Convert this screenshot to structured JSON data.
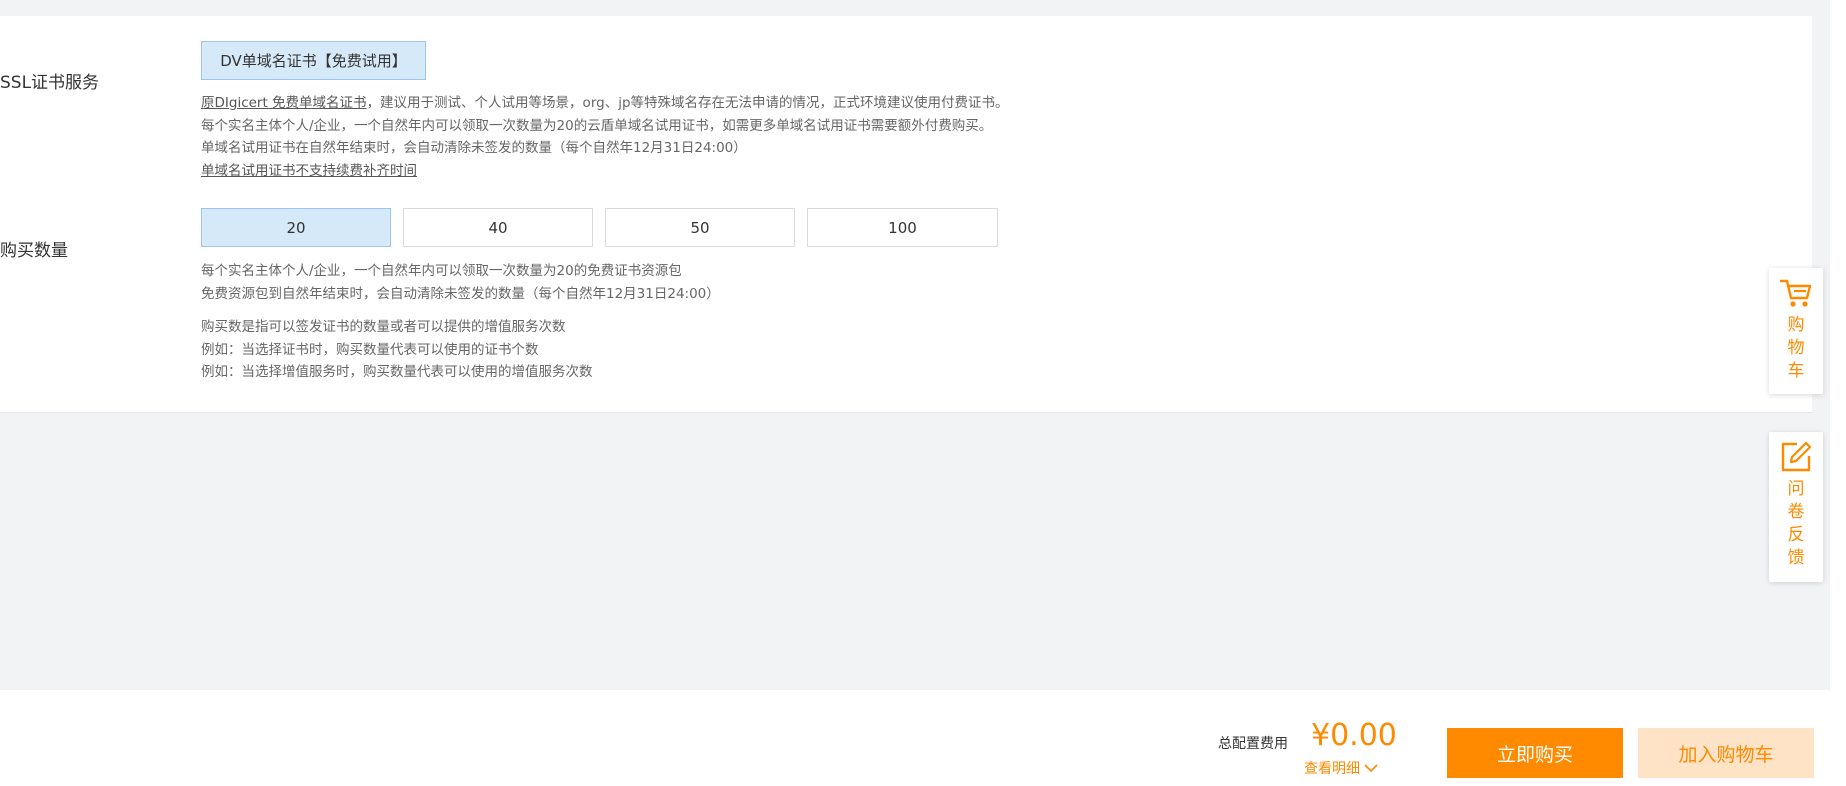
{
  "ssl_section": {
    "label": "SSL证书服务",
    "option": "DV单域名证书【免费试用】",
    "desc_link": "原DIgicert 免费单域名证书",
    "desc_line1_rest": "，建议用于测试、个人试用等场景，org、jp等特殊域名存在无法申请的情况，正式环境建议使用付费证书。",
    "desc_line2": "每个实名主体个人/企业，一个自然年内可以领取一次数量为20的云盾单域名试用证书，如需更多单域名试用证书需要额外付费购买。",
    "desc_line3": "单域名试用证书在自然年结束时，会自动清除未签发的数量（每个自然年12月31日24:00）",
    "desc_line4": "单域名试用证书不支持续费补齐时间"
  },
  "quantity_section": {
    "label": "购买数量",
    "options": [
      "20",
      "40",
      "50",
      "100"
    ],
    "selected": "20",
    "notes1": [
      "每个实名主体个人/企业，一个自然年内可以领取一次数量为20的免费证书资源包",
      "免费资源包到自然年结束时，会自动清除未签发的数量（每个自然年12月31日24:00）"
    ],
    "notes2": [
      "购买数是指可以签发证书的数量或者可以提供的增值服务次数",
      "例如：当选择证书时，购买数量代表可以使用的证书个数",
      "例如：当选择增值服务时，购买数量代表可以使用的增值服务次数"
    ]
  },
  "footer": {
    "total_label": "总配置费用",
    "total_price": "¥0.00",
    "detail_link": "查看明细",
    "buy_now": "立即购买",
    "add_to_cart": "加入购物车"
  },
  "floating": {
    "cart_label": "购物车",
    "survey_label": "问卷反馈",
    "cart_icon": "shopping-cart-icon",
    "survey_icon": "edit-icon"
  },
  "colors": {
    "accent": "#ff8a00",
    "selected_bg": "#d6e9f8",
    "selected_border": "#9dc6ea",
    "page_bg": "#f2f3f5"
  }
}
